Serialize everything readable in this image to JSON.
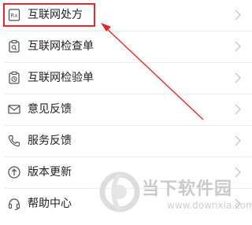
{
  "menu": {
    "items": [
      {
        "label": "互联网处方",
        "icon": "prescription-icon"
      },
      {
        "label": "互联网检查单",
        "icon": "check-form-icon"
      },
      {
        "label": "互联网检验单",
        "icon": "test-form-icon"
      },
      {
        "label": "意见反馈",
        "icon": "mail-icon"
      },
      {
        "label": "服务反馈",
        "icon": "phone-icon"
      },
      {
        "label": "版本更新",
        "icon": "upload-icon"
      },
      {
        "label": "帮助中心",
        "icon": "headset-icon"
      }
    ]
  },
  "annotation": {
    "highlight_color": "#e6262d",
    "arrow_color": "#e6262d"
  },
  "watermark": {
    "title": "当下软件园",
    "url": "www.downxia.com"
  }
}
